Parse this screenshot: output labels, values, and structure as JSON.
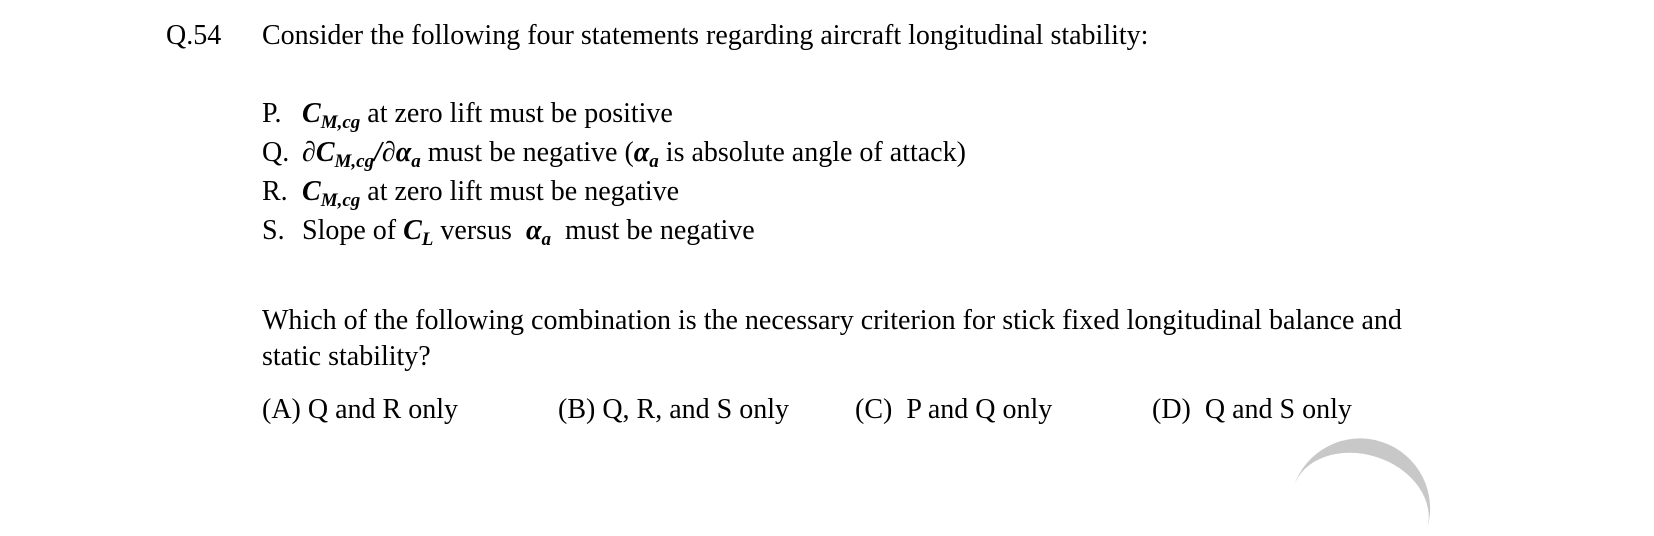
{
  "question": {
    "number": "Q.54",
    "stem": "Consider the following four statements regarding aircraft longitudinal stability:",
    "statements": [
      {
        "label": "P.",
        "symbol_main": "C",
        "symbol_sub": "M,cg",
        "text": " at zero lift must be positive"
      },
      {
        "label": "Q.",
        "prefix": "∂",
        "symbol_main": "C",
        "symbol_sub": "M,cg",
        "divider": "/∂",
        "symbol2_main": "α",
        "symbol2_sub": "a",
        "text_a": " must be negative (",
        "symbol3_main": "α",
        "symbol3_sub": "a",
        "text_b": " is absolute angle of attack)"
      },
      {
        "label": "R.",
        "symbol_main": "C",
        "symbol_sub": "M,cg",
        "text": " at zero lift must be negative"
      },
      {
        "label": "S.",
        "text_a": "Slope of ",
        "symbol_main": "C",
        "symbol_sub": "L",
        "text_b": " versus  ",
        "symbol2_main": "α",
        "symbol2_sub": "a",
        "text_c": "  must be negative"
      }
    ],
    "criterion": "Which of the following combination is the necessary criterion for stick fixed longitudinal balance and static stability?",
    "options": [
      {
        "label": "(A) Q and R only"
      },
      {
        "label": "(B) Q, R, and S only"
      },
      {
        "label": "(C)  P and Q only"
      },
      {
        "label": "(D)  Q and S only"
      }
    ]
  }
}
